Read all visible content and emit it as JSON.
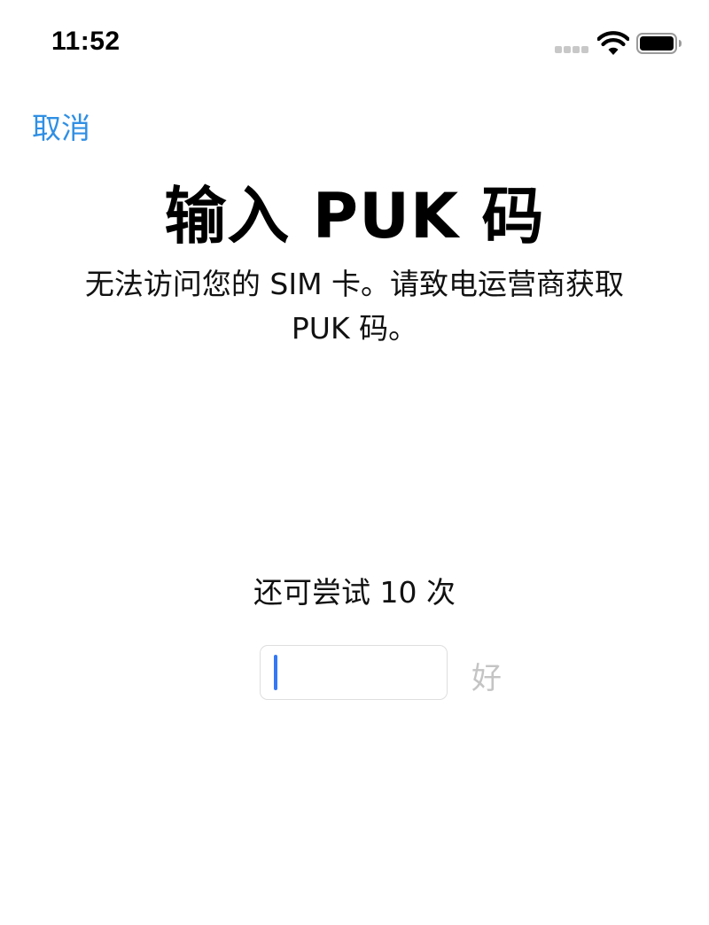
{
  "status_bar": {
    "time": "11:52"
  },
  "nav": {
    "cancel_label": "取消"
  },
  "title": "输入 PUK 码",
  "subtitle_line1": "无法访问您的 SIM 卡。请致电运营商获取",
  "subtitle_line2": "PUK 码。",
  "attempts_label": "还可尝试 10 次",
  "puk_input": {
    "value": "",
    "placeholder": ""
  },
  "ok_label": "好",
  "colors": {
    "accent": "#2f8fe4",
    "caret": "#3478f6",
    "disabled": "#c4c4c4"
  },
  "icons": [
    "cellular-signal-icon",
    "wifi-icon",
    "battery-icon"
  ]
}
